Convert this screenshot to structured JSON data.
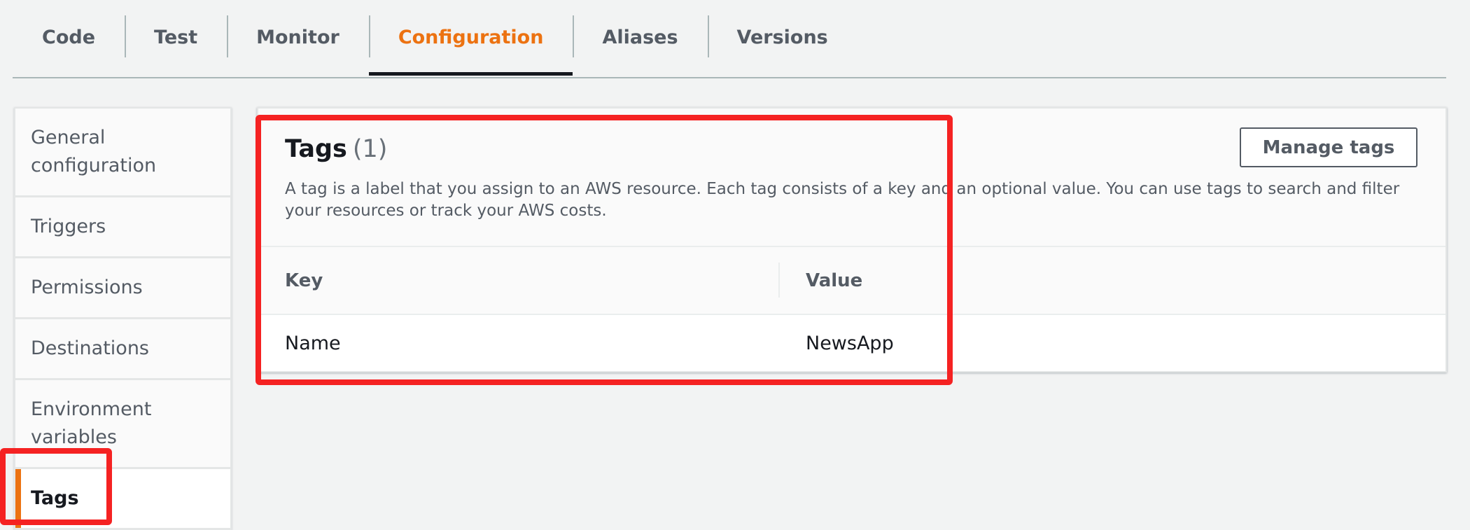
{
  "tabs": [
    {
      "label": "Code"
    },
    {
      "label": "Test"
    },
    {
      "label": "Monitor"
    },
    {
      "label": "Configuration",
      "active": true
    },
    {
      "label": "Aliases"
    },
    {
      "label": "Versions"
    }
  ],
  "sidenav": {
    "items": [
      {
        "label_line1": "General",
        "label_line2": "configuration"
      },
      {
        "label_line1": "Triggers",
        "label_line2": ""
      },
      {
        "label_line1": "Permissions",
        "label_line2": ""
      },
      {
        "label_line1": "Destinations",
        "label_line2": ""
      },
      {
        "label_line1": "Environment",
        "label_line2": "variables"
      },
      {
        "label_line1": "Tags",
        "label_line2": "",
        "active": true
      }
    ]
  },
  "tags_panel": {
    "title": "Tags",
    "count": "(1)",
    "description": "A tag is a label that you assign to an AWS resource. Each tag consists of a key and an optional value. You can use tags to search and filter your resources or track your AWS costs.",
    "manage_button": "Manage tags",
    "columns": {
      "key": "Key",
      "value": "Value"
    },
    "rows": [
      {
        "key": "Name",
        "value": "NewsApp"
      }
    ]
  },
  "colors": {
    "accent": "#ec7211",
    "highlight": "#f52222",
    "background": "#f2f3f3"
  }
}
